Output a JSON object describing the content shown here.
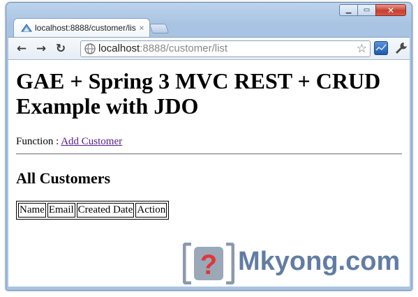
{
  "window": {
    "controls": {
      "minimize": "▁",
      "maximize": "▭",
      "close": "✕"
    }
  },
  "tab": {
    "title": "localhost:8888/customer/lis",
    "close": "×"
  },
  "toolbar": {
    "back": "←",
    "forward": "→",
    "reload": "↻",
    "url_host": "localhost",
    "url_rest": ":8888/customer/list",
    "star": "☆"
  },
  "page": {
    "heading": "GAE + Spring 3 MVC REST + CRUD Example with JDO",
    "function_label": "Function : ",
    "add_customer_link": "Add Customer",
    "section_title": "All Customers",
    "table_headers": [
      "Name",
      "Email",
      "Created Date",
      "Action"
    ]
  },
  "watermark": {
    "text": "Mkyong.com",
    "logo_glyph": "?"
  },
  "colors": {
    "frame": "#a9c4e3",
    "link_visited": "#551a8b",
    "watermark": "#506f9a"
  },
  "icons": [
    "browser-logo-icon",
    "globe-icon",
    "star-icon",
    "extension-icon",
    "wrench-icon",
    "mkyong-logo-icon"
  ]
}
